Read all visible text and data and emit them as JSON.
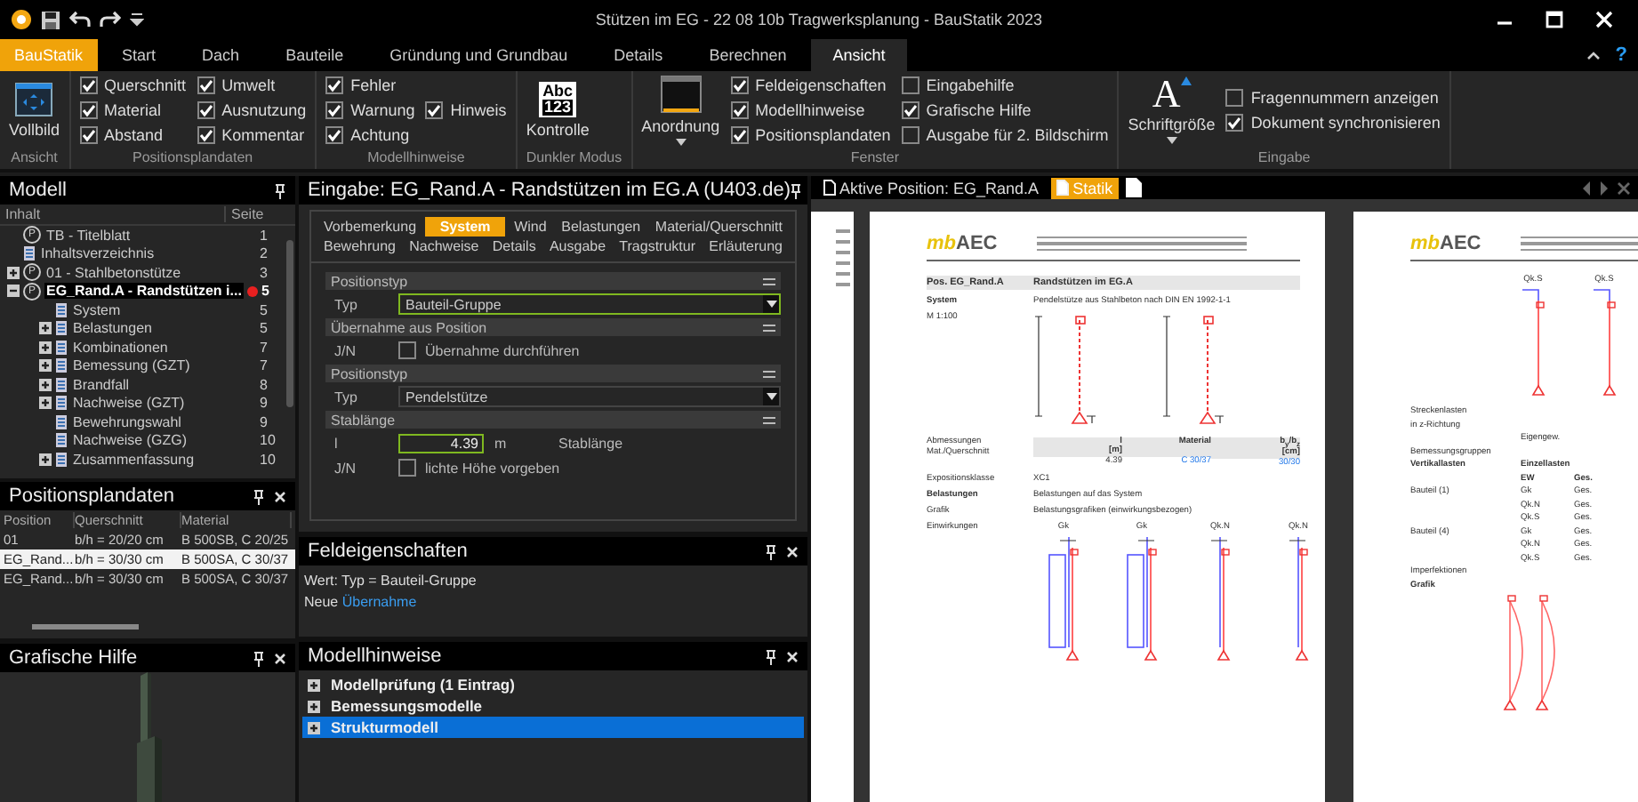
{
  "window": {
    "title": "Stützen im EG - 22 08 10b Tragwerksplanung - BauStatik 2023"
  },
  "ribbon": {
    "app_tab": "BauStatik",
    "help": "?",
    "tabs": [
      {
        "label": "Start",
        "selected": false
      },
      {
        "label": "Dach",
        "selected": false
      },
      {
        "label": "Bauteile",
        "selected": false
      },
      {
        "label": "Gründung und Grundbau",
        "selected": false
      },
      {
        "label": "Details",
        "selected": false
      },
      {
        "label": "Berechnen",
        "selected": false
      },
      {
        "label": "Ansicht",
        "selected": true
      }
    ],
    "groups": [
      {
        "label": "Ansicht",
        "button": {
          "kind": "fullscreen",
          "label": "Vollbild"
        }
      },
      {
        "label": "Positionsplandaten",
        "columns": [
          [
            {
              "label": "Querschnitt",
              "checked": true
            },
            {
              "label": "Material",
              "checked": true
            },
            {
              "label": "Abstand",
              "checked": true
            }
          ],
          [
            {
              "label": "Umwelt",
              "checked": true
            },
            {
              "label": "Ausnutzung",
              "checked": true
            },
            {
              "label": "Kommentar",
              "checked": true
            }
          ]
        ]
      },
      {
        "label": "Modellhinweise",
        "columns": [
          [
            {
              "label": "Fehler",
              "checked": true
            },
            {
              "label": "Warnung",
              "checked": true
            },
            {
              "label": "Achtung",
              "checked": true
            }
          ],
          [
            {
              "label": "Hinweis",
              "checked": true
            }
          ]
        ]
      },
      {
        "label": "Dunkler Modus",
        "button": {
          "kind": "contrast",
          "label": "Kontrolle",
          "icon_text": [
            "Abc",
            "123"
          ]
        }
      },
      {
        "label": "Fenster",
        "button": {
          "kind": "window",
          "label": "Anordnung",
          "dropdown": true
        },
        "columns": [
          [
            {
              "label": "Feldeigenschaften",
              "checked": true
            },
            {
              "label": "Modellhinweise",
              "checked": true
            },
            {
              "label": "Positionsplandaten",
              "checked": true
            }
          ],
          [
            {
              "label": "Eingabehilfe",
              "checked": false
            },
            {
              "label": "Grafische Hilfe",
              "checked": true
            },
            {
              "label": "Ausgabe für 2. Bildschirm",
              "checked": false
            }
          ]
        ]
      },
      {
        "label": "Eingabe",
        "button": {
          "kind": "font",
          "label": "Schriftgröße",
          "icon_text": [
            "A"
          ],
          "dropdown": true
        },
        "columns": [
          [
            {
              "label": "Fragennummern anzeigen",
              "checked": false
            },
            {
              "label": "Dokument synchronisieren",
              "checked": true
            }
          ]
        ]
      }
    ]
  },
  "model": {
    "title": "Modell",
    "columns": [
      "Inhalt",
      "Seite"
    ],
    "tree": [
      {
        "label": "TB - Titelblatt",
        "page": "1",
        "kind": "position",
        "badge": "P",
        "selected": false
      },
      {
        "label": "Inhaltsverzeichnis",
        "page": "2",
        "kind": "document",
        "selected": false
      },
      {
        "label": "01 - Stahlbetonstütze",
        "page": "3",
        "kind": "position",
        "badge": "P",
        "expanded": false,
        "selected": false
      },
      {
        "label": "EG_Rand.A - Randstützen i...",
        "page": "5",
        "kind": "position",
        "badge": "P",
        "expanded": true,
        "selected": true,
        "error": true,
        "children": [
          {
            "label": "System",
            "page": "5",
            "kind": "document",
            "selected": false
          },
          {
            "label": "Belastungen",
            "page": "5",
            "kind": "document",
            "expanded": false,
            "selected": false
          },
          {
            "label": "Kombinationen",
            "page": "7",
            "kind": "document",
            "expanded": false,
            "selected": false
          },
          {
            "label": "Bemessung (GZT)",
            "page": "7",
            "kind": "document",
            "expanded": false,
            "selected": false
          },
          {
            "label": "Brandfall",
            "page": "8",
            "kind": "document",
            "expanded": false,
            "selected": false
          },
          {
            "label": "Nachweise (GZT)",
            "page": "9",
            "kind": "document",
            "expanded": false,
            "selected": false
          },
          {
            "label": "Bewehrungswahl",
            "page": "9",
            "kind": "document",
            "selected": false
          },
          {
            "label": "Nachweise (GZG)",
            "page": "10",
            "kind": "document",
            "selected": false
          },
          {
            "label": "Zusammenfassung",
            "page": "10",
            "kind": "document",
            "expanded": false,
            "selected": false
          }
        ]
      }
    ]
  },
  "plan": {
    "title": "Positionsplandaten",
    "closable": true,
    "columns": [
      "Position",
      "Querschnitt",
      "Material"
    ],
    "rows": [
      {
        "cells": [
          "01",
          "b/h = 20/20 cm",
          "B 500SB, C 20/25"
        ],
        "selected": false
      },
      {
        "cells": [
          "EG_Rand...",
          "b/h = 30/30 cm",
          "B 500SA, C 30/37"
        ],
        "selected": true
      },
      {
        "cells": [
          "EG_Rand...",
          "b/h = 30/30 cm",
          "B 500SA, C 30/37"
        ],
        "selected": false
      }
    ]
  },
  "graphic": {
    "title": "Grafische Hilfe",
    "closable": true
  },
  "input": {
    "title": "Eingabe: EG_Rand.A - Randstützen im EG.A (U403.de)",
    "tab_rows": [
      [
        {
          "label": "Vorbemerkung",
          "selected": false
        },
        {
          "label": "System",
          "selected": true
        },
        {
          "label": "Wind",
          "selected": false
        },
        {
          "label": "Belastungen",
          "selected": false
        },
        {
          "label": "Material/Querschnitt",
          "selected": false
        }
      ],
      [
        {
          "label": "Bewehrung",
          "selected": false
        },
        {
          "label": "Nachweise",
          "selected": false
        },
        {
          "label": "Details",
          "selected": false
        },
        {
          "label": "Ausgabe",
          "selected": false
        },
        {
          "label": "Tragstruktur",
          "selected": false
        },
        {
          "label": "Erläuterung",
          "selected": false
        }
      ]
    ],
    "sections": [
      {
        "title": "Positionstyp",
        "rows": [
          {
            "kind": "select",
            "label": "Typ",
            "value": "Bauteil-Gruppe",
            "focused": true
          }
        ]
      },
      {
        "title": "Übernahme aus Position",
        "rows": [
          {
            "kind": "check",
            "label": "J/N",
            "text": "Übernahme durchführen",
            "checked": false
          }
        ]
      },
      {
        "title": "Positionstyp",
        "rows": [
          {
            "kind": "select",
            "label": "Typ",
            "value": "Pendelstütze",
            "focused": false
          }
        ]
      },
      {
        "title": "Stablänge",
        "rows": [
          {
            "kind": "number",
            "label": "l",
            "value": "4.39",
            "unit": "m",
            "note": "Stablänge",
            "focused": true
          },
          {
            "kind": "check",
            "label": "J/N",
            "text": "lichte Höhe vorgeben",
            "checked": false
          }
        ]
      }
    ]
  },
  "field_props": {
    "title": "Feldeigenschaften",
    "closable": true,
    "value_line": "Wert: Typ = Bauteil-Gruppe",
    "prefix": "Neue",
    "link": "Übernahme"
  },
  "hints": {
    "title": "Modellhinweise",
    "closable": true,
    "items": [
      {
        "label": "Modellprüfung (1 Eintrag)",
        "selected": false
      },
      {
        "label": "Bemessungsmodelle",
        "selected": false
      },
      {
        "label": "Strukturmodell",
        "selected": true
      }
    ]
  },
  "document": {
    "tabs": [
      {
        "label": "Aktive Position: EG_Rand.A",
        "selected": false
      },
      {
        "label": "Statik",
        "selected": true
      }
    ],
    "page1": {
      "logo": [
        "mb",
        "AEC"
      ],
      "title": [
        "Pos. EG_Rand.A",
        "Randstützen im EG.A"
      ],
      "blocks": [
        {
          "kind": "row",
          "label": "System",
          "text": "Pendelstütze aus Stahlbeton nach DIN EN 1992-1-1",
          "bold": true
        },
        {
          "kind": "system",
          "label": "M 1:100"
        },
        {
          "kind": "table",
          "labels": [
            "Abmessungen",
            "Mat./Querschnitt"
          ],
          "columns": [
            {
              "header": "l",
              "unit": "[m]",
              "value": "4.39",
              "link": false
            },
            {
              "header": "Material",
              "value": "C 30/37",
              "link": true
            },
            {
              "header": "b$_{y}$/b$_{z}$",
              "unit": "[cm]",
              "value": "30/30",
              "link": true
            }
          ]
        },
        {
          "kind": "row",
          "label": "Expositionsklasse",
          "text": "XC1",
          "bold": false
        },
        {
          "kind": "row",
          "label": "Belastungen",
          "text": "Belastungen auf das System",
          "bold": true
        },
        {
          "kind": "row",
          "label": "Grafik",
          "text": "Belastungsgrafiken (einwirkungsbezogen)",
          "bold": false
        },
        {
          "kind": "loads",
          "label": "Einwirkungen",
          "items": [
            {
              "label": "Gk",
              "kind": "distributed"
            },
            {
              "label": "Gk",
              "kind": "distributed"
            },
            {
              "label": "Qk.N",
              "kind": "point"
            },
            {
              "label": "Qk.N",
              "kind": "point"
            }
          ]
        }
      ]
    },
    "page2": {
      "logo": [
        "mb",
        "AEC"
      ],
      "blocks": [
        {
          "kind": "loads",
          "items": [
            {
              "label": "Qk.S",
              "kind": "point"
            },
            {
              "label": "Qk.S",
              "kind": "point"
            }
          ]
        },
        {
          "kind": "grid",
          "rows": [
            {
              "label": "Streckenlasten"
            },
            {
              "label": "in z-Richtung"
            },
            {
              "cells": [
                "Eigengew."
              ]
            },
            {
              "label": "Bemessungsgruppen"
            },
            {
              "label": "Vertikallasten",
              "bold": true,
              "cells": [
                "Einzellasten"
              ]
            },
            {
              "cells": [
                "EW",
                "Ges."
              ],
              "bold": true
            },
            {
              "label": "Bauteil (1)",
              "cells": [
                "Gk",
                "Ges."
              ]
            },
            {
              "cells": [
                "Qk.N",
                "Ges."
              ]
            },
            {
              "cells": [
                "Qk.S",
                "Ges."
              ]
            },
            {
              "label": "Bauteil (4)",
              "cells": [
                "Gk",
                "Ges."
              ]
            },
            {
              "cells": [
                "Qk.N",
                "Ges."
              ]
            },
            {
              "cells": [
                "Qk.S",
                "Ges."
              ]
            },
            {
              "label": "Imperfektionen"
            },
            {
              "label": "Grafik",
              "bold": true
            }
          ]
        },
        {
          "kind": "imperfection"
        }
      ]
    }
  }
}
